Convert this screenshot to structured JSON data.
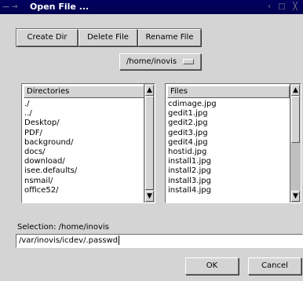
{
  "window": {
    "title": "Open File ...",
    "controls": "‹ □ ╳"
  },
  "toolbar": {
    "create_dir": "Create Dir",
    "delete_file": "Delete File",
    "rename_file": "Rename File"
  },
  "path_menu": {
    "selected": "/home/inovis"
  },
  "directories": {
    "header": "Directories",
    "items": [
      "./",
      "../",
      "Desktop/",
      "PDF/",
      "background/",
      "docs/",
      "download/",
      "isee.defaults/",
      "nsmail/",
      "office52/"
    ]
  },
  "files": {
    "header": "Files",
    "items": [
      "cdimage.jpg",
      "gedit1.jpg",
      "gedit2.jpg",
      "gedit3.jpg",
      "gedit4.jpg",
      "hostid.jpg",
      "install1.jpg",
      "install2.jpg",
      "install3.jpg",
      "install4.jpg"
    ]
  },
  "selection": {
    "label": "Selection: /home/inovis",
    "value": "/var/inovis/icdev/.passwd"
  },
  "actions": {
    "ok": "OK",
    "cancel": "Cancel"
  },
  "colors": {
    "titlebar": "#000050",
    "background": "#d4d4d4"
  }
}
